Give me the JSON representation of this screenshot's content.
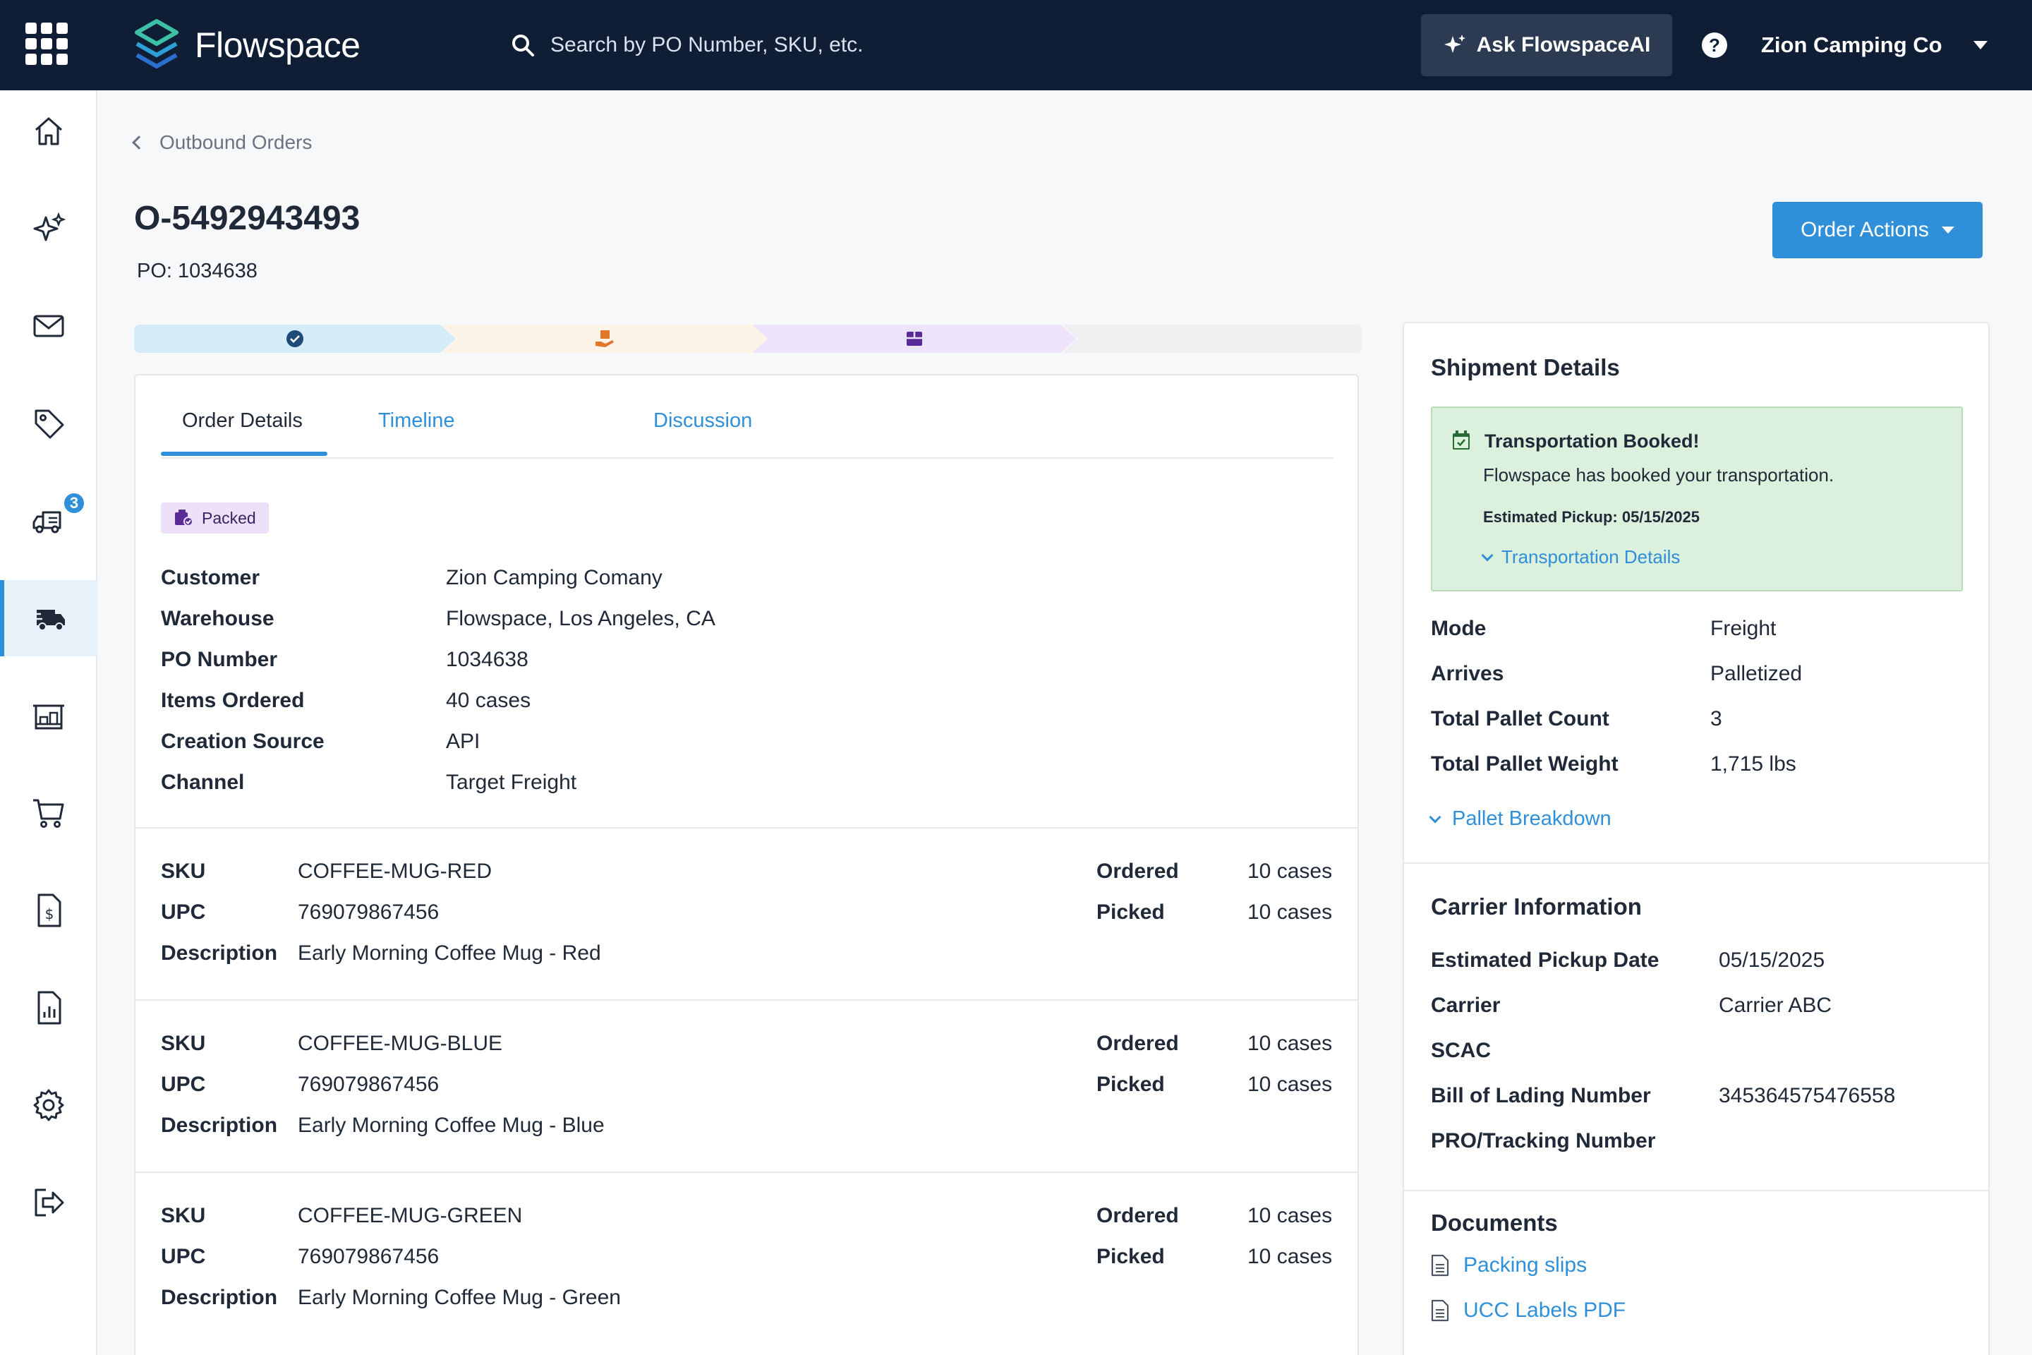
{
  "topbar": {
    "brand": "Flowspace",
    "search_placeholder": "Search by PO Number, SKU, etc.",
    "ask_ai_label": "Ask FlowspaceAI",
    "help_glyph": "?",
    "account_name": "Zion Camping Co"
  },
  "sidebar": {
    "items": [
      {
        "icon": "home-icon"
      },
      {
        "icon": "sparkles-icon"
      },
      {
        "icon": "mail-icon"
      },
      {
        "icon": "tag-icon"
      },
      {
        "icon": "delivery-truck-icon",
        "badge": "3"
      },
      {
        "icon": "outbound-truck-icon",
        "active": true
      },
      {
        "icon": "warehouse-icon"
      },
      {
        "icon": "cart-icon"
      },
      {
        "icon": "invoice-icon"
      },
      {
        "icon": "report-icon"
      },
      {
        "icon": "gear-icon"
      },
      {
        "icon": "logout-icon"
      }
    ]
  },
  "header": {
    "breadcrumb": "Outbound Orders",
    "order_number": "O-5492943493",
    "po_line": "PO: 1034638",
    "order_actions_label": "Order Actions"
  },
  "progress": {
    "steps": [
      {
        "icon": "check-circle-icon",
        "state": "complete"
      },
      {
        "icon": "hand-box-icon",
        "state": "complete"
      },
      {
        "icon": "box-icon",
        "state": "current"
      },
      {
        "icon": "",
        "state": "pending"
      }
    ],
    "colors": {
      "step1": "#d5ebf7",
      "step2": "#fdf3e7",
      "step3": "#ede3fb",
      "step4": "#efefef"
    }
  },
  "tabs": [
    {
      "label": "Order Details",
      "active": true
    },
    {
      "label": "Timeline"
    },
    {
      "label": "Discussion"
    }
  ],
  "status": {
    "label": "Packed",
    "color": "#ece1f8"
  },
  "order_details": [
    {
      "label": "Customer",
      "value": "Zion Camping Comany"
    },
    {
      "label": "Warehouse",
      "value": "Flowspace, Los Angeles, CA"
    },
    {
      "label": "PO Number",
      "value": "1034638"
    },
    {
      "label": "Items Ordered",
      "value": "40 cases"
    },
    {
      "label": "Creation Source",
      "value": "API"
    },
    {
      "label": "Channel",
      "value": "Target Freight"
    }
  ],
  "line_labels": {
    "sku": "SKU",
    "upc": "UPC",
    "description": "Description",
    "ordered": "Ordered",
    "picked": "Picked"
  },
  "line_items": [
    {
      "sku": "COFFEE-MUG-RED",
      "upc": "769079867456",
      "description": "Early Morning Coffee Mug - Red",
      "ordered": "10 cases",
      "picked": "10 cases"
    },
    {
      "sku": "COFFEE-MUG-BLUE",
      "upc": "769079867456",
      "description": "Early Morning Coffee Mug - Blue",
      "ordered": "10 cases",
      "picked": "10 cases"
    },
    {
      "sku": "COFFEE-MUG-GREEN",
      "upc": "769079867456",
      "description": "Early Morning Coffee Mug - Green",
      "ordered": "10 cases",
      "picked": "10 cases"
    }
  ],
  "shipment": {
    "title": "Shipment Details",
    "banner": {
      "title": "Transportation Booked!",
      "message": "Flowspace has booked your transportation.",
      "pickup": "Estimated Pickup: 05/15/2025",
      "link": "Transportation Details",
      "color": "#dbf0dd"
    },
    "rows": [
      {
        "label": "Mode",
        "value": "Freight"
      },
      {
        "label": "Arrives",
        "value": "Palletized"
      },
      {
        "label": "Total Pallet Count",
        "value": "3"
      },
      {
        "label": "Total Pallet Weight",
        "value": "1,715 lbs"
      }
    ],
    "pallet_link": "Pallet Breakdown"
  },
  "carrier": {
    "title": "Carrier Information",
    "rows": [
      {
        "label": "Estimated Pickup Date",
        "value": "05/15/2025"
      },
      {
        "label": "Carrier",
        "value": "Carrier ABC"
      },
      {
        "label": "SCAC",
        "value": ""
      },
      {
        "label": "Bill of Lading Number",
        "value": "345364575476558"
      },
      {
        "label": "PRO/Tracking Number",
        "value": ""
      }
    ]
  },
  "documents": {
    "title": "Documents",
    "items": [
      {
        "label": "Packing slips"
      },
      {
        "label": "UCC Labels PDF"
      }
    ]
  },
  "colors": {
    "topbar": "#0f1d35",
    "accent": "#2f8fd8"
  }
}
